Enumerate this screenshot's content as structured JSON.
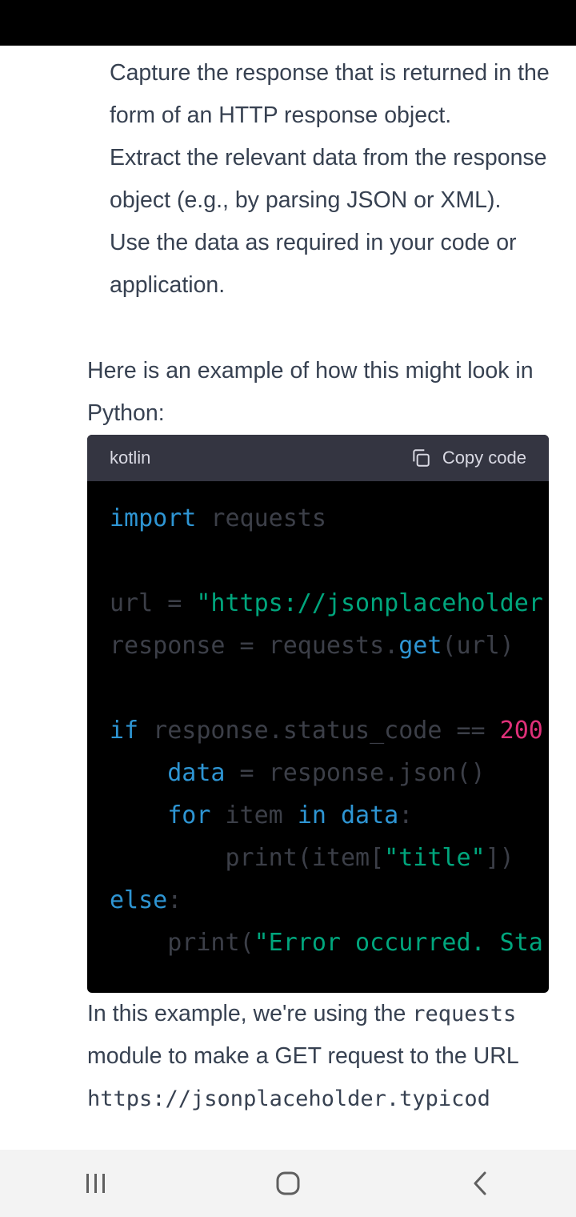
{
  "list_items": [
    "Capture the response that is returned in the form of an HTTP response object.",
    "Extract the relevant data from the response object (e.g., by parsing JSON or XML).",
    "Use the data as required in your code or application."
  ],
  "intro": "Here is an example of how this might look in Python:",
  "code_block": {
    "language": "kotlin",
    "copy_label": "Copy code",
    "lines": [
      [
        [
          "kw",
          "import"
        ],
        [
          "dim",
          " requests"
        ]
      ],
      [],
      [
        [
          "dim",
          "url = "
        ],
        [
          "str",
          "\"https://jsonplaceholder"
        ]
      ],
      [
        [
          "dim",
          "response = requests."
        ],
        [
          "kw",
          "get"
        ],
        [
          "dim",
          "(url)"
        ]
      ],
      [],
      [
        [
          "kw",
          "if"
        ],
        [
          "dim",
          " response.status_code == "
        ],
        [
          "num",
          "200"
        ]
      ],
      [
        [
          "dim",
          "    "
        ],
        [
          "kw",
          "data"
        ],
        [
          "dim",
          " = response.json()"
        ]
      ],
      [
        [
          "dim",
          "    "
        ],
        [
          "kw",
          "for"
        ],
        [
          "dim",
          " item "
        ],
        [
          "kw",
          "in"
        ],
        [
          "dim",
          " "
        ],
        [
          "kw",
          "data"
        ],
        [
          "dim",
          ":"
        ]
      ],
      [
        [
          "dim",
          "        print(item["
        ],
        [
          "str",
          "\"title\""
        ],
        [
          "dim",
          "])"
        ]
      ],
      [
        [
          "kw",
          "else"
        ],
        [
          "dim",
          ":"
        ]
      ],
      [
        [
          "dim",
          "    print("
        ],
        [
          "str",
          "\"Error occurred. Sta"
        ]
      ]
    ]
  },
  "explanation": {
    "part1": "In this example, we're using the ",
    "module": "requests",
    "part2": " module to make a GET request to the URL ",
    "url": "https://jsonplaceholder.typicod"
  },
  "nav": {
    "recents_icon": "recents-icon",
    "home_icon": "home-icon",
    "back_icon": "back-icon"
  }
}
